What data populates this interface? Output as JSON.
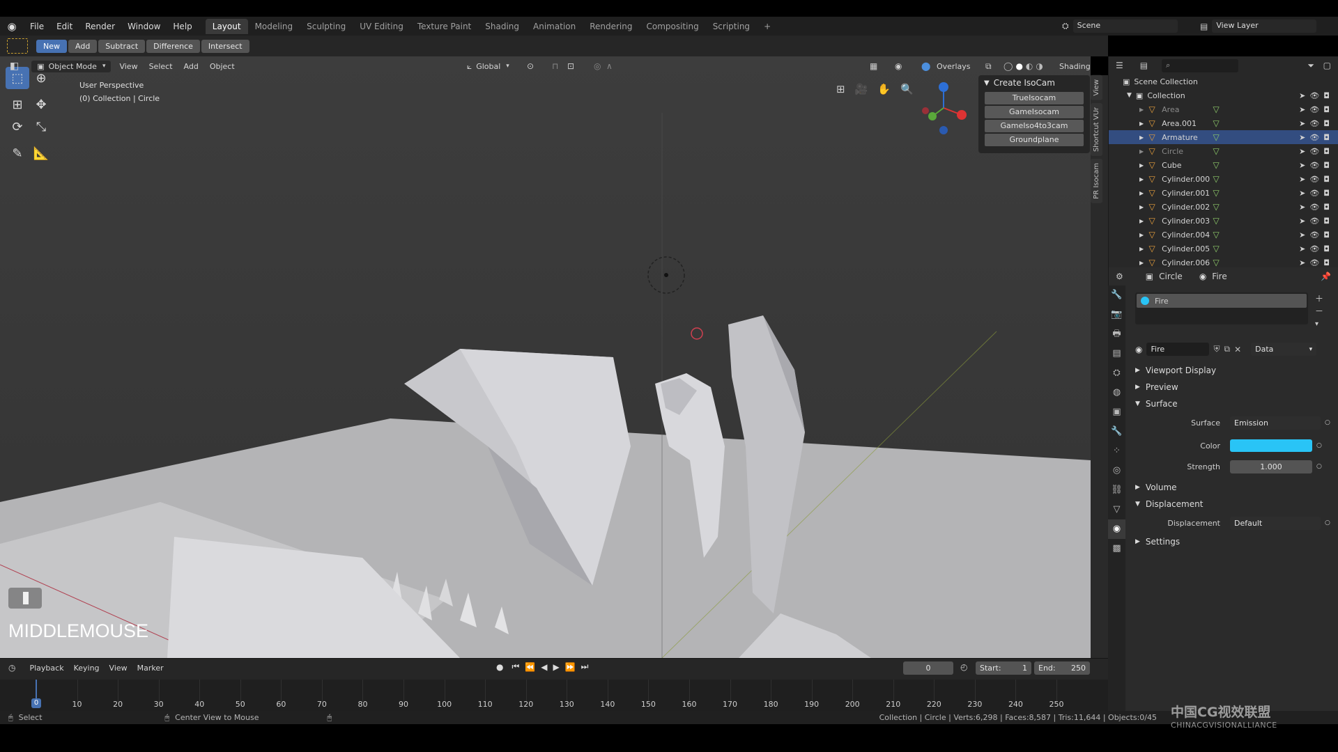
{
  "topbar": {
    "menus": [
      "File",
      "Edit",
      "Render",
      "Window",
      "Help"
    ],
    "workspaces": [
      "Layout",
      "Modeling",
      "Sculpting",
      "UV Editing",
      "Texture Paint",
      "Shading",
      "Animation",
      "Rendering",
      "Compositing",
      "Scripting"
    ],
    "active_workspace": "Layout",
    "add_tab": "+",
    "scene": "Scene",
    "view_layer": "View Layer"
  },
  "tool_header": {
    "buttons": [
      "New",
      "Add",
      "Subtract",
      "Difference",
      "Intersect"
    ],
    "active": "New"
  },
  "viewport_header": {
    "mode": "Object Mode",
    "menus": [
      "View",
      "Select",
      "Add",
      "Object"
    ],
    "orientation": "Global",
    "overlays": "Overlays",
    "shading": "Shading"
  },
  "viewport": {
    "perspective": "User Perspective",
    "collection_info": "(0) Collection | Circle",
    "key_overlay": "MIDDLEMOUSE"
  },
  "isocam_panel": {
    "title": "Create IsoCam",
    "buttons": [
      "TrueIsocam",
      "GameIsocam",
      "GameIso4to3cam",
      "Groundplane"
    ]
  },
  "n_panel_tabs": [
    "View",
    "Shortcut VUr",
    "PR Isocam"
  ],
  "outliner": {
    "search_placeholder": "",
    "scene_collection": "Scene Collection",
    "collection": "Collection",
    "items": [
      {
        "name": "Area",
        "dim": true,
        "selected": false
      },
      {
        "name": "Area.001",
        "dim": false,
        "selected": false
      },
      {
        "name": "Armature",
        "dim": false,
        "selected": true
      },
      {
        "name": "Circle",
        "dim": true,
        "selected": false
      },
      {
        "name": "Cube",
        "dim": false,
        "selected": false
      },
      {
        "name": "Cylinder.000",
        "dim": false,
        "selected": false
      },
      {
        "name": "Cylinder.001",
        "dim": false,
        "selected": false
      },
      {
        "name": "Cylinder.002",
        "dim": false,
        "selected": false
      },
      {
        "name": "Cylinder.003",
        "dim": false,
        "selected": false
      },
      {
        "name": "Cylinder.004",
        "dim": false,
        "selected": false
      },
      {
        "name": "Cylinder.005",
        "dim": false,
        "selected": false
      },
      {
        "name": "Cylinder.006",
        "dim": false,
        "selected": false
      }
    ]
  },
  "properties": {
    "breadcrumb_object": "Circle",
    "breadcrumb_material": "Fire",
    "slot_name": "Fire",
    "material_name": "Fire",
    "link_mode": "Data",
    "panels": {
      "viewport_display": "Viewport Display",
      "preview": "Preview",
      "surface": "Surface",
      "volume": "Volume",
      "displacement": "Displacement",
      "settings": "Settings"
    },
    "surface_label": "Surface",
    "surface_value": "Emission",
    "color_label": "Color",
    "color_value": "#29c4f6",
    "strength_label": "Strength",
    "strength_value": "1.000",
    "displacement_label": "Displacement",
    "displacement_value": "Default"
  },
  "timeline": {
    "menus": [
      "Playback",
      "Keying",
      "View",
      "Marker"
    ],
    "current_frame": "0",
    "start_label": "Start:",
    "start_value": "1",
    "end_label": "End:",
    "end_value": "250",
    "ticks": [
      "0",
      "10",
      "20",
      "30",
      "40",
      "50",
      "60",
      "70",
      "80",
      "90",
      "100",
      "110",
      "120",
      "130",
      "140",
      "150",
      "160",
      "170",
      "180",
      "190",
      "200",
      "210",
      "220",
      "230",
      "240",
      "250"
    ],
    "playhead_label": "0"
  },
  "status_bar": {
    "left": "Select",
    "middle": "Center View to Mouse",
    "right": "Collection | Circle | Verts:6,298 | Faces:8,587 | Tris:11,644 | Objects:0/45"
  },
  "watermark": {
    "line1": "中国CG视效联盟",
    "line2": "CHINACGVISIONALLIANCE"
  },
  "colors": {
    "accent": "#4772b3",
    "selected_row": "#334d80",
    "emission_color": "#29c4f6"
  }
}
